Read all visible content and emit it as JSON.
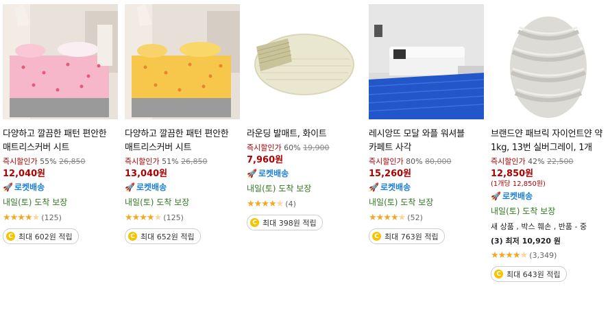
{
  "products": [
    {
      "name": "다양하고 깔끔한 패턴 편안한 매트리스커버 시트",
      "discount_label": "즉시할인가",
      "discount_rate": "55%",
      "original_price": "26,850",
      "price": "12,040원",
      "rocket": "로켓배송",
      "delivery": "내일(토) 도착 보장",
      "rating": 4.5,
      "review_count": "(125)",
      "reward": "최대 602원 적립"
    },
    {
      "name": "다양하고 깔끔한 패턴 편안한 매트리스커버 시트",
      "discount_label": "즉시할인가",
      "discount_rate": "51%",
      "original_price": "26,850",
      "price": "13,040원",
      "rocket": "로켓배송",
      "delivery": "내일(토) 도착 보장",
      "rating": 4.5,
      "review_count": "(125)",
      "reward": "최대 652원 적립"
    },
    {
      "name": "라운딩 발매트, 화이트",
      "discount_label": "즉시할인가",
      "discount_rate": "60%",
      "original_price": "19,900",
      "price": "7,960원",
      "rocket": "로켓배송",
      "delivery": "내일(토) 도착 보장",
      "rating": 4.5,
      "review_count": "(4)",
      "reward": "최대 398원 적립"
    },
    {
      "name": "레시앙뜨 모달 와플 워셔블 카페트 사각",
      "discount_label": "즉시할인가",
      "discount_rate": "80%",
      "original_price": "80,000",
      "price": "15,260원",
      "rocket": "로켓배송",
      "delivery": "내일(토) 도착 보장",
      "rating": 4.5,
      "review_count": "(52)",
      "reward": "최대 763원 적립"
    },
    {
      "name": "브랜드얀 패브릭 자이언트얀 약 1kg, 13번 실버그레이, 1개",
      "discount_label": "즉시할인가",
      "discount_rate": "42%",
      "original_price": "22,500",
      "price": "12,850원",
      "unit_price": "(1개당 12,850원)",
      "rocket": "로켓배송",
      "delivery": "내일(토) 도착 보장",
      "other_sellers_a": "새 상품 , 박스 훼손 , 반품 - 중",
      "other_sellers_b": "(3) 최저 10,920 원",
      "rating": 4.5,
      "review_count": "(3,349)",
      "reward": "최대 643원 적립"
    }
  ],
  "colors": {
    "price": "#ae0000",
    "rocket": "#1a7fd8",
    "delivery": "#2d7a1f",
    "star": "#f5a623",
    "coin": "#f5c400"
  },
  "icons": {
    "rocket": "rocket-icon",
    "star": "star-icon",
    "coin": "coin-icon"
  }
}
